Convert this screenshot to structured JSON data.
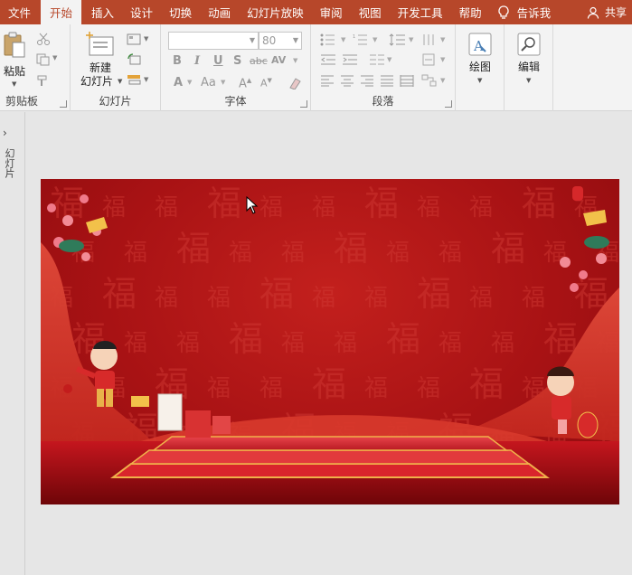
{
  "tabs": [
    {
      "label": "文件",
      "active": false
    },
    {
      "label": "开始",
      "active": true
    },
    {
      "label": "插入",
      "active": false
    },
    {
      "label": "设计",
      "active": false
    },
    {
      "label": "切换",
      "active": false
    },
    {
      "label": "动画",
      "active": false
    },
    {
      "label": "幻灯片放映",
      "active": false
    },
    {
      "label": "审阅",
      "active": false
    },
    {
      "label": "视图",
      "active": false
    },
    {
      "label": "开发工具",
      "active": false
    },
    {
      "label": "帮助",
      "active": false
    }
  ],
  "tell_me": "告诉我",
  "share": "共享",
  "groups": {
    "clipboard": {
      "label": "剪贴板",
      "paste": "粘贴"
    },
    "slides": {
      "label": "幻灯片",
      "new_slide_line1": "新建",
      "new_slide_line2": "幻灯片"
    },
    "font": {
      "label": "字体",
      "font_name": "",
      "font_size": "80",
      "bold": "B",
      "italic": "I",
      "underline": "U",
      "shadow": "S",
      "strike": "abc",
      "spacing": "AV",
      "font_color": "A",
      "change_case": "Aa"
    },
    "paragraph": {
      "label": "段落"
    },
    "drawing": {
      "label": "绘图"
    },
    "editing": {
      "label": "编辑"
    }
  },
  "thumbnail_panel_label": "幻灯片",
  "colors": {
    "brand": "#b7472a",
    "slide_red": "#b5161a",
    "gold": "#e9a23b"
  },
  "slide": {
    "background_glyph": "福"
  }
}
